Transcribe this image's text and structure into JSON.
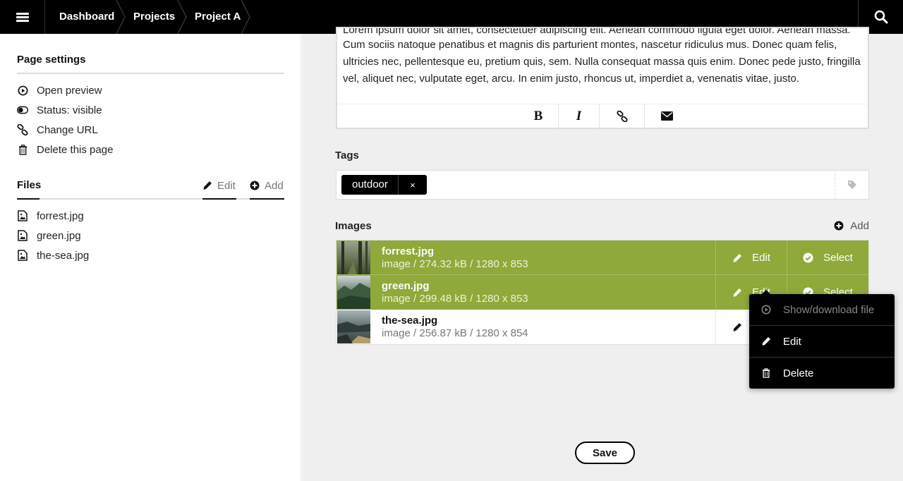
{
  "topbar": {
    "breadcrumbs": [
      "Dashboard",
      "Projects",
      "Project A"
    ]
  },
  "sidebar": {
    "page_settings_title": "Page settings",
    "settings_items": [
      {
        "label": "Open preview",
        "icon": "play-circle-icon"
      },
      {
        "label": "Status: visible",
        "icon": "toggle-on-icon"
      },
      {
        "label": "Change URL",
        "icon": "chain-link-icon"
      },
      {
        "label": "Delete this page",
        "icon": "trash-icon"
      }
    ],
    "files_title": "Files",
    "files_edit": "Edit",
    "files_add": "Add",
    "files": [
      "forrest.jpg",
      "green.jpg",
      "the-sea.jpg"
    ]
  },
  "editor": {
    "text_partial_top": "Lorem ipsum dolor sit amet, consectetuer adipiscing elit. Aenean commodo ligula eget dolor. Aenean massa.",
    "text": "Cum sociis natoque penatibus et magnis dis parturient montes, nascetur ridiculus mus. Donec quam felis, ultricies nec, pellentesque eu, pretium quis, sem. Nulla consequat massa quis enim. Donec pede justo, fringilla vel, aliquet nec, vulputate eget, arcu. In enim justo, rhoncus ut, imperdiet a, venenatis vitae, justo.",
    "toolbar": {
      "bold": "B",
      "italic": "I"
    }
  },
  "tags": {
    "label": "Tags",
    "items": [
      "outdoor"
    ],
    "remove_glyph": "×"
  },
  "images": {
    "label": "Images",
    "add": "Add",
    "rows": [
      {
        "name": "forrest.jpg",
        "meta": "image / 274.32 kB / 1280 x 853",
        "edit": "Edit",
        "select": "Select",
        "selected": true
      },
      {
        "name": "green.jpg",
        "meta": "image / 299.48 kB / 1280 x 853",
        "edit": "Edit",
        "select": "Select",
        "selected": true
      },
      {
        "name": "the-sea.jpg",
        "meta": "image / 256.87 kB / 1280 x 854",
        "selected": false
      }
    ]
  },
  "context_menu": {
    "items": [
      {
        "label": "Show/download file",
        "icon": "play-circle-icon",
        "disabled": true
      },
      {
        "label": "Edit",
        "icon": "pencil-icon",
        "disabled": false
      },
      {
        "label": "Delete",
        "icon": "trash-icon",
        "disabled": false
      }
    ]
  },
  "save_label": "Save",
  "colors": {
    "accent": "#8fa93a",
    "topbar": "#000000",
    "main_bg": "#efefef"
  }
}
